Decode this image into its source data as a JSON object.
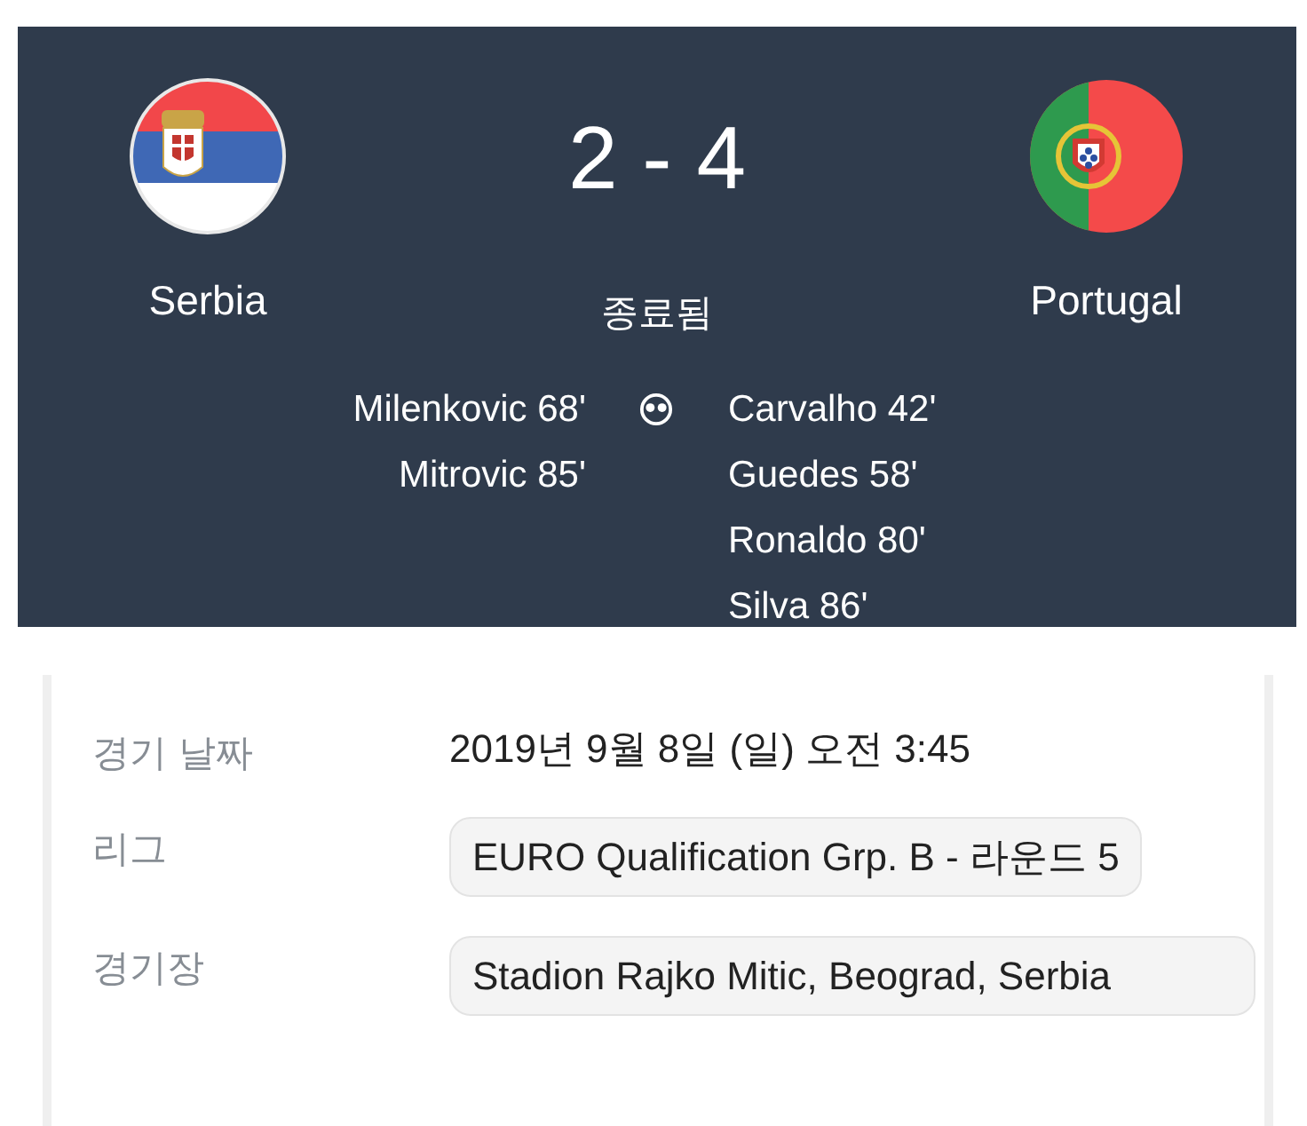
{
  "match": {
    "home": {
      "name": "Serbia"
    },
    "away": {
      "name": "Portugal"
    },
    "score": "2 - 4",
    "status": "종료됨",
    "home_goals": [
      "Milenkovic 68'",
      "Mitrovic 85'"
    ],
    "away_goals": [
      "Carvalho 42'",
      "Guedes 58'",
      "Ronaldo 80'",
      "Silva 86'"
    ]
  },
  "details": [
    {
      "label": "경기 날짜",
      "value": "2019년 9월 8일 (일) 오전 3:45",
      "kind": "text"
    },
    {
      "label": "리그",
      "value": "EURO Qualification Grp. B - 라운드 5",
      "kind": "chip"
    },
    {
      "label": "경기장",
      "value": "Stadion Rajko Mitic, Beograd, Serbia",
      "kind": "chip"
    }
  ]
}
